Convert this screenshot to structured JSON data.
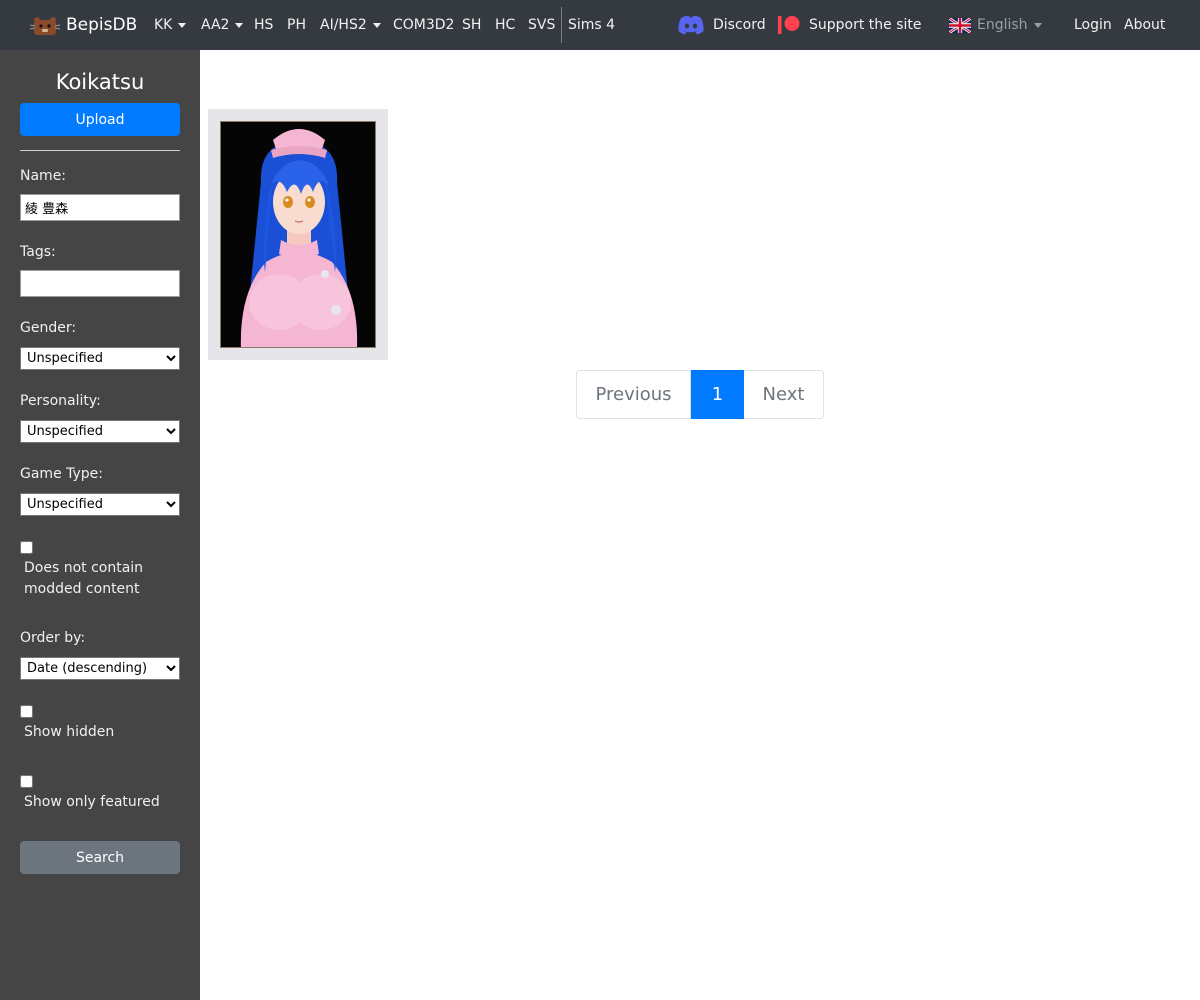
{
  "navbar": {
    "brand": "BepisDB",
    "items": [
      {
        "label": "KK",
        "dropdown": true
      },
      {
        "label": "AA2",
        "dropdown": true
      },
      {
        "label": "HS",
        "dropdown": false
      },
      {
        "label": "PH",
        "dropdown": false
      },
      {
        "label": "AI/HS2",
        "dropdown": true
      },
      {
        "label": "COM3D2",
        "dropdown": false
      },
      {
        "label": "SH",
        "dropdown": false
      },
      {
        "label": "HC",
        "dropdown": false
      },
      {
        "label": "SVS",
        "dropdown": false
      },
      {
        "label": "Sims 4",
        "dropdown": false
      }
    ],
    "discord": "Discord",
    "support": "Support the site",
    "language": "English",
    "login": "Login",
    "about": "About",
    "icons": {
      "brand": "bear-logo-icon",
      "discord": "discord-icon",
      "support": "patreon-icon",
      "language": "uk-flag-icon"
    },
    "colors": {
      "background": "#343a40",
      "discord": "#5865f2",
      "patreon": "#ff424d"
    }
  },
  "sidebar": {
    "title": "Koikatsu",
    "upload_label": "Upload",
    "name_label": "Name:",
    "name_value": "綾 豊森",
    "tags_label": "Tags:",
    "tags_value": "",
    "gender_label": "Gender:",
    "gender_value": "Unspecified",
    "personality_label": "Personality:",
    "personality_value": "Unspecified",
    "gametype_label": "Game Type:",
    "gametype_value": "Unspecified",
    "no_mods_label": "Does not contain modded content",
    "no_mods_checked": false,
    "order_label": "Order by:",
    "order_value": "Date (descending)",
    "show_hidden_label": "Show hidden",
    "show_hidden_checked": false,
    "featured_label": "Show only featured",
    "featured_checked": false,
    "search_label": "Search",
    "colors": {
      "background": "#454545",
      "primary": "#007bff",
      "secondary": "#6c757d"
    }
  },
  "results": {
    "cards": [
      {
        "icon": "character-card-thumbnail-icon"
      }
    ]
  },
  "pagination": {
    "previous": "Previous",
    "current": "1",
    "next": "Next",
    "colors": {
      "active": "#007bff"
    }
  }
}
